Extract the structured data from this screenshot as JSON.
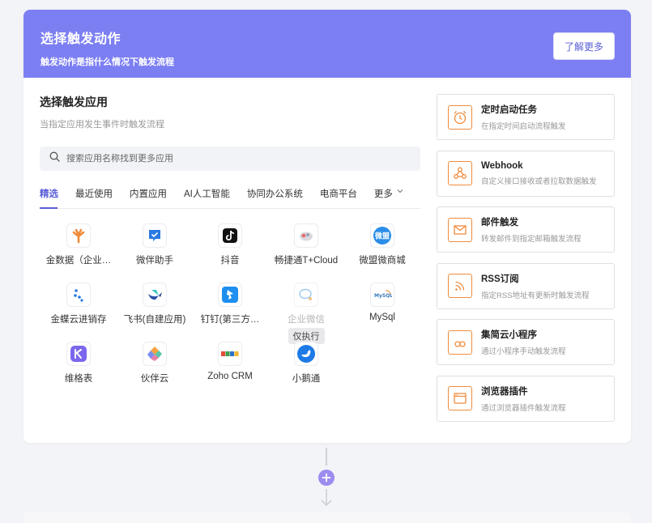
{
  "header": {
    "title": "选择触发动作",
    "subtitle": "触发动作是指什么情况下触发流程",
    "learn_more": "了解更多"
  },
  "section": {
    "title": "选择触发应用",
    "subtitle": "当指定应用发生事件时触发流程"
  },
  "search": {
    "placeholder": "搜索应用名称找到更多应用"
  },
  "tabs": [
    "精选",
    "最近使用",
    "内置应用",
    "AI人工智能",
    "协同办公系统",
    "电商平台",
    "更多"
  ],
  "apps": [
    {
      "name": "金数据（企业…",
      "icon": "jinshuju-icon"
    },
    {
      "name": "微伴助手",
      "icon": "weiban-icon"
    },
    {
      "name": "抖音",
      "icon": "douyin-icon"
    },
    {
      "name": "畅捷通T+Cloud",
      "icon": "chanjet-icon"
    },
    {
      "name": "微盟微商城",
      "icon": "weimob-icon"
    },
    {
      "name": "金蝶云进销存",
      "icon": "kingdee-icon"
    },
    {
      "name": "飞书(自建应用)",
      "icon": "feishu-icon"
    },
    {
      "name": "钉钉(第三方…",
      "icon": "dingtalk-icon"
    },
    {
      "name": "企业微信",
      "icon": "wecom-icon",
      "badge": "仅执行"
    },
    {
      "name": "MySql",
      "icon": "mysql-icon"
    },
    {
      "name": "维格表",
      "icon": "vika-icon"
    },
    {
      "name": "伙伴云",
      "icon": "huoban-icon"
    },
    {
      "name": "Zoho CRM",
      "icon": "zoho-icon"
    },
    {
      "name": "小鹅通",
      "icon": "xiaoe-icon"
    }
  ],
  "triggers": [
    {
      "title": "定时启动任务",
      "desc": "在指定时间启动流程触发",
      "icon": "alarm-clock-icon"
    },
    {
      "title": "Webhook",
      "desc": "自定义接口接收或者拉取数据触发",
      "icon": "webhook-icon"
    },
    {
      "title": "邮件触发",
      "desc": "转发邮件到指定邮箱触发流程",
      "icon": "mail-icon"
    },
    {
      "title": "RSS订阅",
      "desc": "指定RSS地址有更新时触发流程",
      "icon": "rss-icon"
    },
    {
      "title": "集简云小程序",
      "desc": "通过小程序手动触发流程",
      "icon": "mini-program-icon"
    },
    {
      "title": "浏览器插件",
      "desc": "通过浏览器插件触发流程",
      "icon": "browser-plugin-icon"
    }
  ],
  "colors": {
    "accent": "#7c7ff2",
    "trigger_icon": "#f08c3c"
  }
}
